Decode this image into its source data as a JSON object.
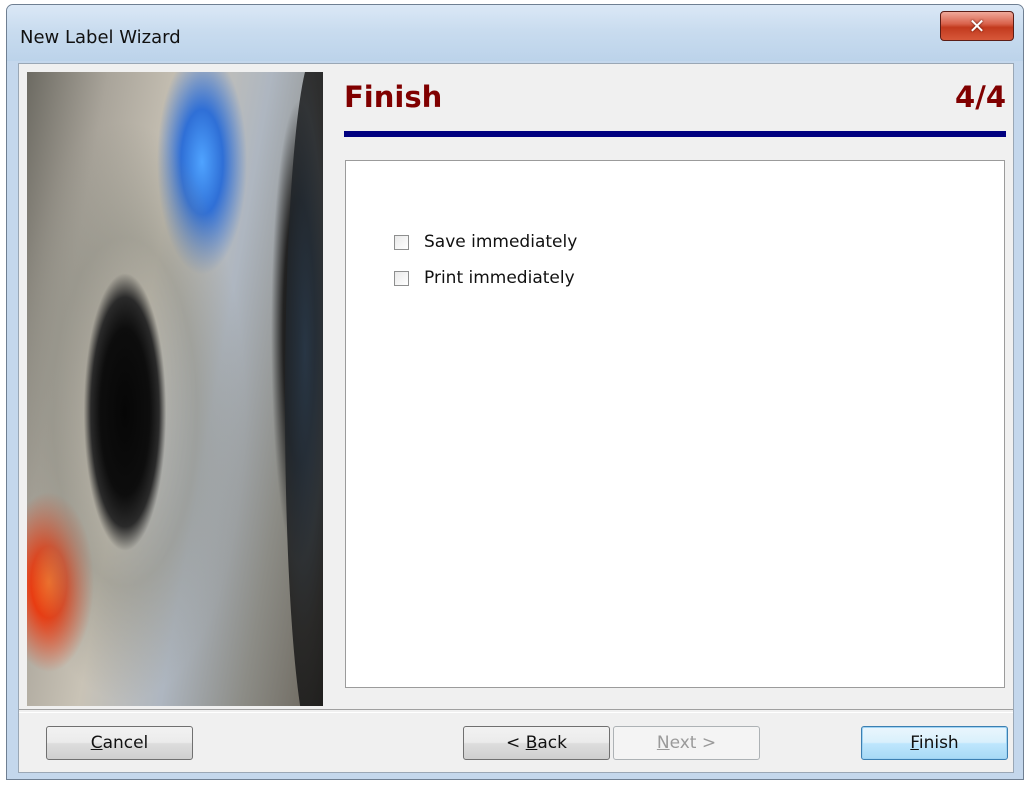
{
  "window": {
    "title": "New Label Wizard",
    "close_glyph": "✕"
  },
  "header": {
    "title": "Finish",
    "step": "4/4"
  },
  "options": [
    {
      "label": "Save immediately",
      "checked": false
    },
    {
      "label": "Print immediately",
      "checked": false
    }
  ],
  "buttons": {
    "cancel": {
      "label": "Cancel",
      "underline": "C"
    },
    "back": {
      "label": "< Back",
      "underline": "B"
    },
    "next": {
      "label": "Next >",
      "underline": "N",
      "enabled": false
    },
    "finish": {
      "label": "Finish",
      "underline": "F"
    }
  },
  "side_image": {
    "subject": "cd-disc-photo"
  },
  "colors": {
    "header_text": "#800000",
    "header_rule": "#000080",
    "close_button": "#c9452a"
  }
}
